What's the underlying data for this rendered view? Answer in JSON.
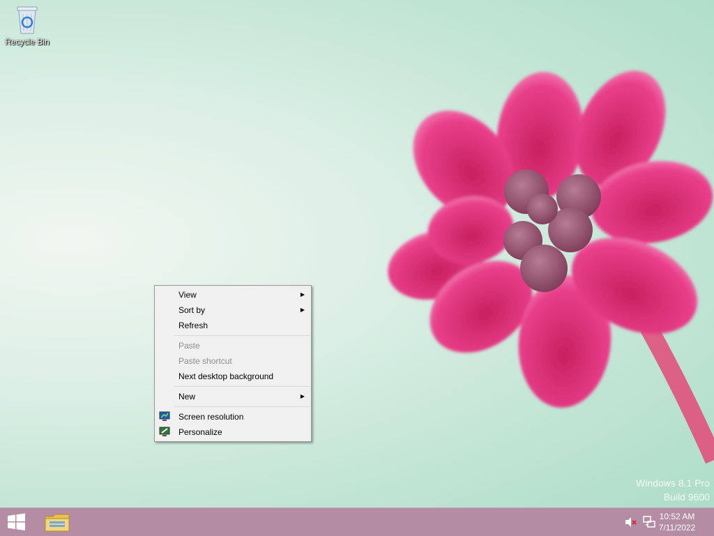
{
  "desktop": {
    "icons": [
      {
        "label": "Recycle Bin",
        "icon": "recycle-bin-icon"
      }
    ],
    "watermark": {
      "line1": "Windows 8.1 Pro",
      "line2": "Build 9600"
    }
  },
  "context_menu": {
    "items": [
      {
        "label": "View",
        "has_submenu": true,
        "enabled": true
      },
      {
        "label": "Sort by",
        "has_submenu": true,
        "enabled": true
      },
      {
        "label": "Refresh",
        "enabled": true
      },
      {
        "label": "Paste",
        "enabled": false
      },
      {
        "label": "Paste shortcut",
        "enabled": false
      },
      {
        "label": "Next desktop background",
        "enabled": true
      },
      {
        "label": "New",
        "has_submenu": true,
        "enabled": true
      },
      {
        "label": "Screen resolution",
        "icon": "monitor-icon",
        "enabled": true
      },
      {
        "label": "Personalize",
        "icon": "personalize-icon",
        "enabled": true
      }
    ],
    "submenu_arrow": "▶"
  },
  "taskbar": {
    "color": "#b48da4",
    "pinned": [
      "start-icon",
      "file-explorer-icon"
    ],
    "tray": [
      "speaker-muted-icon",
      "network-icon"
    ],
    "clock": {
      "time": "10:52 AM",
      "date": "7/11/2022"
    }
  },
  "colors": {
    "flower": "#e23e86",
    "background": "#bfe4d3"
  }
}
